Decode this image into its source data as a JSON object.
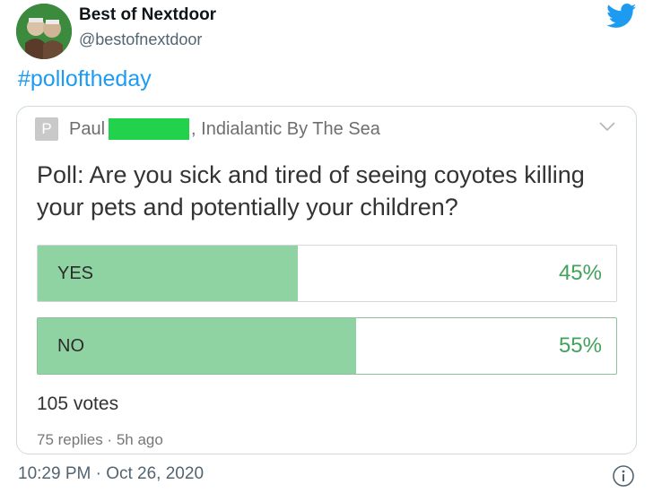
{
  "tweet": {
    "account_name": "Best of Nextdoor",
    "handle": "@bestofnextdoor",
    "hashtag": "#polloftheday",
    "timestamp": "10:29 PM · Oct 26, 2020",
    "brand_color": "#1d9bf0"
  },
  "post": {
    "avatar_letter": "P",
    "author_first": "Paul",
    "location": ", Indialantic By The Sea",
    "question": "Poll: Are you sick and tired of seeing coyotes killing your pets and potentially your children?",
    "options": [
      {
        "label": "YES",
        "percent_text": "45%",
        "percent": 45
      },
      {
        "label": "NO",
        "percent_text": "55%",
        "percent": 55
      }
    ],
    "votes": "105 votes",
    "replies": "75 replies · 5h ago",
    "redaction_color": "#22d14c",
    "bar_color": "#8fd3a2"
  },
  "icons": [
    "avatar",
    "twitter-bird-icon",
    "chevron-down-icon",
    "info-icon"
  ]
}
